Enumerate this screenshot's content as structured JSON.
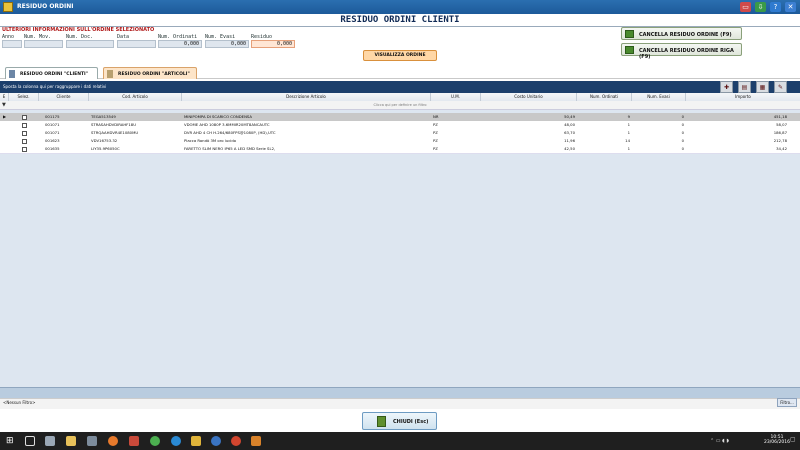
{
  "window": {
    "title": "RESIDUO ORDINI"
  },
  "page": {
    "title": "RESIDUO ORDINI CLIENTI"
  },
  "info": {
    "label": "ULTERIORI INFORMAZIONI SULL'ORDINE SELEZIONATO",
    "fields": [
      {
        "label": "Anno",
        "value": ""
      },
      {
        "label": "Num. Mov.",
        "value": ""
      },
      {
        "label": "Num. Doc.",
        "value": ""
      },
      {
        "label": "Data",
        "value": ""
      },
      {
        "label": "Num. Ordinati",
        "value": "0,000"
      },
      {
        "label": "Num. Evasi",
        "value": "0,000"
      },
      {
        "label": "Residuo",
        "value": "0,000"
      }
    ],
    "visualizza_label": "VISUALIZZA ORDINE"
  },
  "actions": {
    "cancella_residuo": "CANCELLA RESIDUO ORDINE (F9)",
    "cancella_riga": "CANCELLA RESIDUO ORDINE RIGA (F9)"
  },
  "tabs": [
    {
      "label": "RESIDUO ORDINI \"CLIENTI\""
    },
    {
      "label": "RESIDUO ORDINI \"ARTICOLI\""
    }
  ],
  "grid": {
    "group_hint": "Sposta la colonna qui per raggruppare i dati relativi",
    "filter_hint": "Clicca qui per definire un filtro",
    "columns": [
      "E",
      "Selez.",
      "Cliente",
      "Cod. Articolo",
      "Descrizione Articolo",
      "U.M.",
      "Costo Unitario",
      "Num. Ordinati",
      "Num. Evasi",
      "Importo"
    ],
    "rows": [
      {
        "cliente": "001175",
        "codice": "TEGA513549",
        "descrizione": "MINIPOMPA DI SCARICO CONDENSA",
        "um": "NR",
        "costo": "50,49",
        "ordinati": "9",
        "evasi": "0",
        "importo": "451,18"
      },
      {
        "cliente": "001071",
        "codice": "STRASAHDVDIRAHF18U",
        "descrizione": "VDOME AHD 1080P 3.6MMIR20MT8ANCAUTC",
        "um": "PZ",
        "costo": "48,00",
        "ordinati": "1",
        "evasi": "0",
        "importo": "58,07"
      },
      {
        "cliente": "001071",
        "codice": "STRQAAHDVR4E1080MU",
        "descrizione": "DVR AHD 4 CH H.264/680FPS@1080P, (HD),UTC",
        "um": "PZ",
        "costo": "63,70",
        "ordinati": "1",
        "evasi": "0",
        "importo": "186,87"
      },
      {
        "cliente": "001623",
        "codice": "VDV16753.32",
        "descrizione": "Placca Rondò 3M oro lucido",
        "um": "PZ",
        "costo": "11,96",
        "ordinati": "14",
        "evasi": "0",
        "importo": "212,78"
      },
      {
        "cliente": "001635",
        "codice": "LIY35.9P6050C",
        "descrizione": "FARETTO SLIM NERO IP65 A LED SMD Serie SL2,",
        "um": "PZ",
        "costo": "42,50",
        "ordinati": "1",
        "evasi": "0",
        "importo": "34,42"
      }
    ]
  },
  "footer": {
    "no_filter": "<Nessun Filtro>",
    "filter_button": "Filtro...",
    "chiudi_label": "CHIUDI (Esc)"
  },
  "taskbar": {
    "time": "10:51",
    "date": "23/06/2016"
  },
  "colors": {
    "title_bar": "#1d5a9a",
    "grid_header": "#1c3f6c",
    "accent_orange": "#ffd7a6",
    "page_title": "#102a55"
  }
}
